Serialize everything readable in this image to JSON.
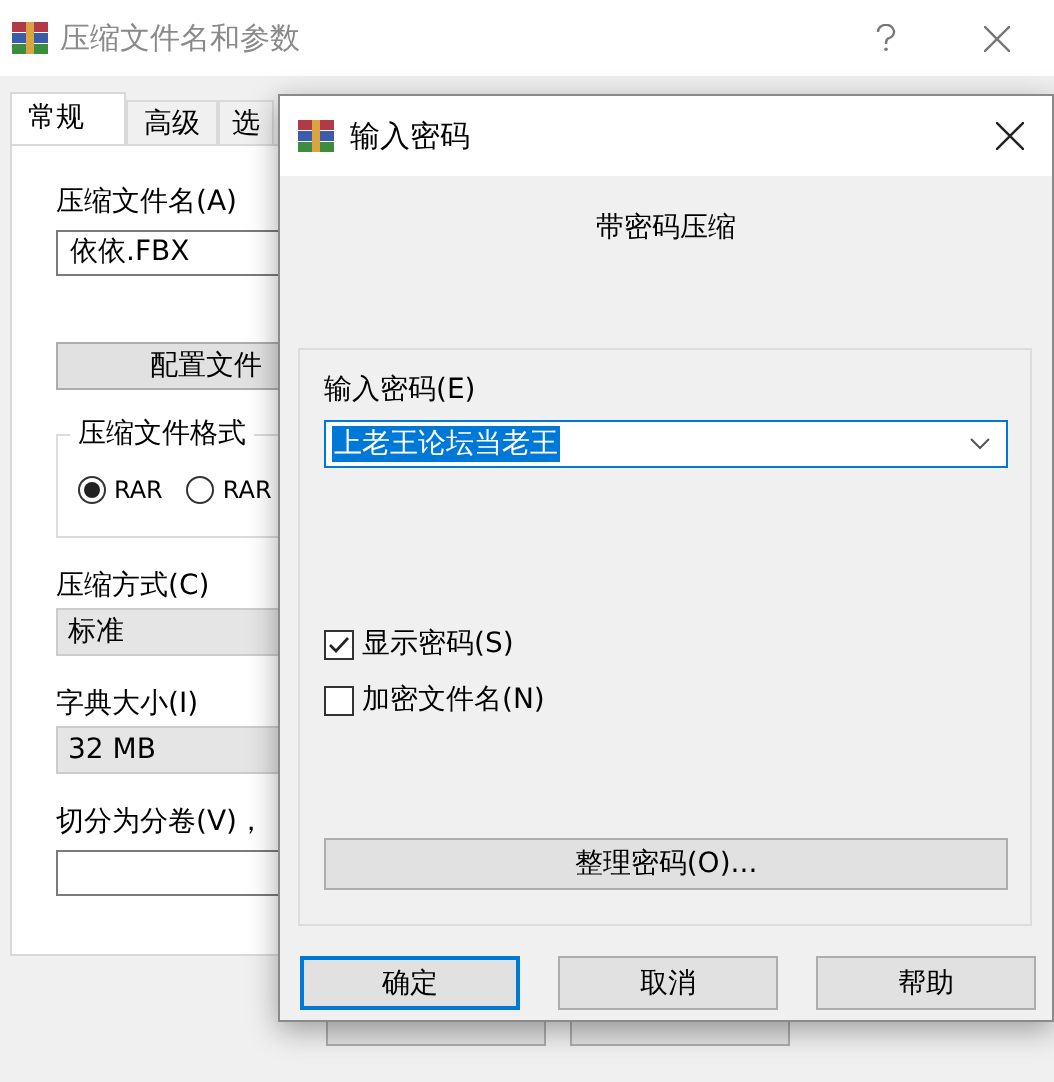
{
  "window": {
    "title": "压缩文件名和参数"
  },
  "tabs": [
    {
      "label": "常规",
      "selected": true
    },
    {
      "label": "高级",
      "selected": false
    },
    {
      "label": "选",
      "selected": false
    }
  ],
  "general": {
    "archive_name_label": "压缩文件名(A)",
    "archive_name": "依依.FBX",
    "profiles_button": "配置文件",
    "format_group": "压缩文件格式",
    "formats": [
      {
        "label": "RAR",
        "selected": true
      },
      {
        "label": "RAR",
        "selected": false
      }
    ],
    "method_label": "压缩方式(C)",
    "method": "标准",
    "dictionary_label": "字典大小(I)",
    "dictionary": "32 MB",
    "split_label": "切分为分卷(V)，"
  },
  "password_dialog": {
    "title": "输入密码",
    "heading": "带密码压缩",
    "password_label": "输入密码(E)",
    "password": "上老王论坛当老王",
    "password_selected": true,
    "options": [
      {
        "label": "显示密码(S)",
        "checked": true
      },
      {
        "label": "加密文件名(N)",
        "checked": false
      }
    ],
    "organize_button": "整理密码(O)...",
    "buttons": [
      {
        "label": "确定",
        "default": true
      },
      {
        "label": "取消",
        "default": false
      },
      {
        "label": "帮助",
        "default": false
      }
    ]
  }
}
